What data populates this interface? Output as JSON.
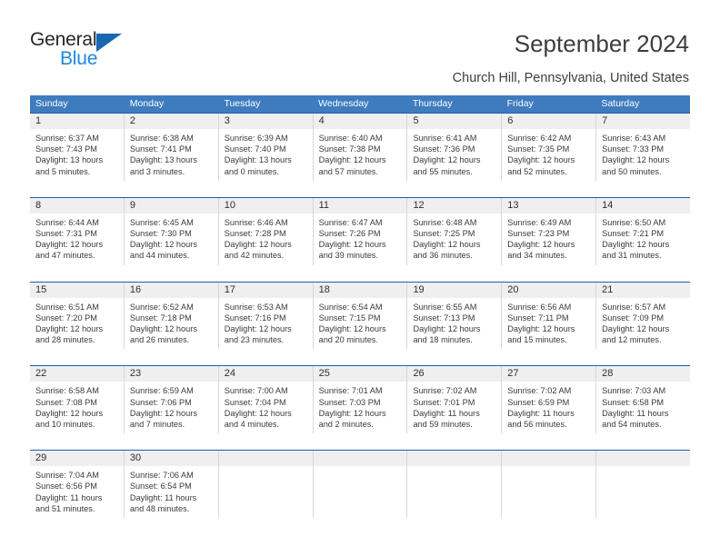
{
  "brand": {
    "name_part1": "General",
    "name_part2": "Blue",
    "triangle_color": "#1767b2",
    "blue_text_color": "#1f86e0"
  },
  "header": {
    "title": "September 2024",
    "subtitle": "Church Hill, Pennsylvania, United States"
  },
  "theme": {
    "header_bar_color": "#3e7cbf",
    "week_divider_color": "#1f5fa9",
    "daynum_band_color": "#efefef",
    "cell_border_color": "#d8d8d8",
    "text_color": "#3a3a3a"
  },
  "weekdays": [
    "Sunday",
    "Monday",
    "Tuesday",
    "Wednesday",
    "Thursday",
    "Friday",
    "Saturday"
  ],
  "weeks": [
    [
      {
        "day": "1",
        "sunrise": "Sunrise: 6:37 AM",
        "sunset": "Sunset: 7:43 PM",
        "daylight1": "Daylight: 13 hours",
        "daylight2": "and 5 minutes."
      },
      {
        "day": "2",
        "sunrise": "Sunrise: 6:38 AM",
        "sunset": "Sunset: 7:41 PM",
        "daylight1": "Daylight: 13 hours",
        "daylight2": "and 3 minutes."
      },
      {
        "day": "3",
        "sunrise": "Sunrise: 6:39 AM",
        "sunset": "Sunset: 7:40 PM",
        "daylight1": "Daylight: 13 hours",
        "daylight2": "and 0 minutes."
      },
      {
        "day": "4",
        "sunrise": "Sunrise: 6:40 AM",
        "sunset": "Sunset: 7:38 PM",
        "daylight1": "Daylight: 12 hours",
        "daylight2": "and 57 minutes."
      },
      {
        "day": "5",
        "sunrise": "Sunrise: 6:41 AM",
        "sunset": "Sunset: 7:36 PM",
        "daylight1": "Daylight: 12 hours",
        "daylight2": "and 55 minutes."
      },
      {
        "day": "6",
        "sunrise": "Sunrise: 6:42 AM",
        "sunset": "Sunset: 7:35 PM",
        "daylight1": "Daylight: 12 hours",
        "daylight2": "and 52 minutes."
      },
      {
        "day": "7",
        "sunrise": "Sunrise: 6:43 AM",
        "sunset": "Sunset: 7:33 PM",
        "daylight1": "Daylight: 12 hours",
        "daylight2": "and 50 minutes."
      }
    ],
    [
      {
        "day": "8",
        "sunrise": "Sunrise: 6:44 AM",
        "sunset": "Sunset: 7:31 PM",
        "daylight1": "Daylight: 12 hours",
        "daylight2": "and 47 minutes."
      },
      {
        "day": "9",
        "sunrise": "Sunrise: 6:45 AM",
        "sunset": "Sunset: 7:30 PM",
        "daylight1": "Daylight: 12 hours",
        "daylight2": "and 44 minutes."
      },
      {
        "day": "10",
        "sunrise": "Sunrise: 6:46 AM",
        "sunset": "Sunset: 7:28 PM",
        "daylight1": "Daylight: 12 hours",
        "daylight2": "and 42 minutes."
      },
      {
        "day": "11",
        "sunrise": "Sunrise: 6:47 AM",
        "sunset": "Sunset: 7:26 PM",
        "daylight1": "Daylight: 12 hours",
        "daylight2": "and 39 minutes."
      },
      {
        "day": "12",
        "sunrise": "Sunrise: 6:48 AM",
        "sunset": "Sunset: 7:25 PM",
        "daylight1": "Daylight: 12 hours",
        "daylight2": "and 36 minutes."
      },
      {
        "day": "13",
        "sunrise": "Sunrise: 6:49 AM",
        "sunset": "Sunset: 7:23 PM",
        "daylight1": "Daylight: 12 hours",
        "daylight2": "and 34 minutes."
      },
      {
        "day": "14",
        "sunrise": "Sunrise: 6:50 AM",
        "sunset": "Sunset: 7:21 PM",
        "daylight1": "Daylight: 12 hours",
        "daylight2": "and 31 minutes."
      }
    ],
    [
      {
        "day": "15",
        "sunrise": "Sunrise: 6:51 AM",
        "sunset": "Sunset: 7:20 PM",
        "daylight1": "Daylight: 12 hours",
        "daylight2": "and 28 minutes."
      },
      {
        "day": "16",
        "sunrise": "Sunrise: 6:52 AM",
        "sunset": "Sunset: 7:18 PM",
        "daylight1": "Daylight: 12 hours",
        "daylight2": "and 26 minutes."
      },
      {
        "day": "17",
        "sunrise": "Sunrise: 6:53 AM",
        "sunset": "Sunset: 7:16 PM",
        "daylight1": "Daylight: 12 hours",
        "daylight2": "and 23 minutes."
      },
      {
        "day": "18",
        "sunrise": "Sunrise: 6:54 AM",
        "sunset": "Sunset: 7:15 PM",
        "daylight1": "Daylight: 12 hours",
        "daylight2": "and 20 minutes."
      },
      {
        "day": "19",
        "sunrise": "Sunrise: 6:55 AM",
        "sunset": "Sunset: 7:13 PM",
        "daylight1": "Daylight: 12 hours",
        "daylight2": "and 18 minutes."
      },
      {
        "day": "20",
        "sunrise": "Sunrise: 6:56 AM",
        "sunset": "Sunset: 7:11 PM",
        "daylight1": "Daylight: 12 hours",
        "daylight2": "and 15 minutes."
      },
      {
        "day": "21",
        "sunrise": "Sunrise: 6:57 AM",
        "sunset": "Sunset: 7:09 PM",
        "daylight1": "Daylight: 12 hours",
        "daylight2": "and 12 minutes."
      }
    ],
    [
      {
        "day": "22",
        "sunrise": "Sunrise: 6:58 AM",
        "sunset": "Sunset: 7:08 PM",
        "daylight1": "Daylight: 12 hours",
        "daylight2": "and 10 minutes."
      },
      {
        "day": "23",
        "sunrise": "Sunrise: 6:59 AM",
        "sunset": "Sunset: 7:06 PM",
        "daylight1": "Daylight: 12 hours",
        "daylight2": "and 7 minutes."
      },
      {
        "day": "24",
        "sunrise": "Sunrise: 7:00 AM",
        "sunset": "Sunset: 7:04 PM",
        "daylight1": "Daylight: 12 hours",
        "daylight2": "and 4 minutes."
      },
      {
        "day": "25",
        "sunrise": "Sunrise: 7:01 AM",
        "sunset": "Sunset: 7:03 PM",
        "daylight1": "Daylight: 12 hours",
        "daylight2": "and 2 minutes."
      },
      {
        "day": "26",
        "sunrise": "Sunrise: 7:02 AM",
        "sunset": "Sunset: 7:01 PM",
        "daylight1": "Daylight: 11 hours",
        "daylight2": "and 59 minutes."
      },
      {
        "day": "27",
        "sunrise": "Sunrise: 7:02 AM",
        "sunset": "Sunset: 6:59 PM",
        "daylight1": "Daylight: 11 hours",
        "daylight2": "and 56 minutes."
      },
      {
        "day": "28",
        "sunrise": "Sunrise: 7:03 AM",
        "sunset": "Sunset: 6:58 PM",
        "daylight1": "Daylight: 11 hours",
        "daylight2": "and 54 minutes."
      }
    ],
    [
      {
        "day": "29",
        "sunrise": "Sunrise: 7:04 AM",
        "sunset": "Sunset: 6:56 PM",
        "daylight1": "Daylight: 11 hours",
        "daylight2": "and 51 minutes."
      },
      {
        "day": "30",
        "sunrise": "Sunrise: 7:06 AM",
        "sunset": "Sunset: 6:54 PM",
        "daylight1": "Daylight: 11 hours",
        "daylight2": "and 48 minutes."
      },
      {
        "day": "",
        "sunrise": "",
        "sunset": "",
        "daylight1": "",
        "daylight2": ""
      },
      {
        "day": "",
        "sunrise": "",
        "sunset": "",
        "daylight1": "",
        "daylight2": ""
      },
      {
        "day": "",
        "sunrise": "",
        "sunset": "",
        "daylight1": "",
        "daylight2": ""
      },
      {
        "day": "",
        "sunrise": "",
        "sunset": "",
        "daylight1": "",
        "daylight2": ""
      },
      {
        "day": "",
        "sunrise": "",
        "sunset": "",
        "daylight1": "",
        "daylight2": ""
      }
    ]
  ]
}
